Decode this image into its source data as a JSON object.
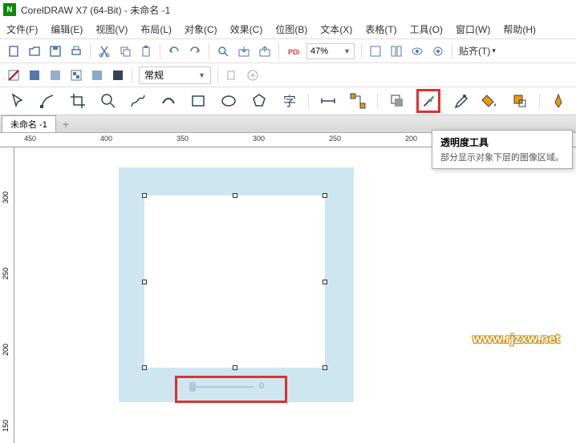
{
  "titlebar": {
    "title": "CorelDRAW X7 (64-Bit) - 未命名 -1"
  },
  "menubar": {
    "items": [
      "文件(F)",
      "编辑(E)",
      "视图(V)",
      "布局(L)",
      "对象(C)",
      "效果(C)",
      "位图(B)",
      "文本(X)",
      "表格(T)",
      "工具(O)",
      "窗口(W)",
      "帮助(H)"
    ]
  },
  "toolbar1": {
    "zoom": "47%",
    "paste_label": "贴齐(T)"
  },
  "toolbar2": {
    "style_label": "常规"
  },
  "toolbar3": {
    "tools": [
      "pick",
      "shape",
      "crop",
      "zoom",
      "freehand",
      "artistic",
      "rect",
      "ellipse",
      "polygon",
      "text",
      "dimension",
      "connector",
      "shadow",
      "transparency",
      "eyedropper",
      "fill",
      "smartfill",
      "pen"
    ]
  },
  "tabs": {
    "active": "未命名 -1"
  },
  "ruler_h": [
    "450",
    "400",
    "350",
    "300",
    "250",
    "200"
  ],
  "ruler_v": [
    "300",
    "250",
    "200",
    "150"
  ],
  "slider": {
    "value": "0"
  },
  "tooltip": {
    "title": "透明度工具",
    "desc": "部分显示对象下层的图像区域。"
  },
  "watermark": "www.rjzxw.net"
}
